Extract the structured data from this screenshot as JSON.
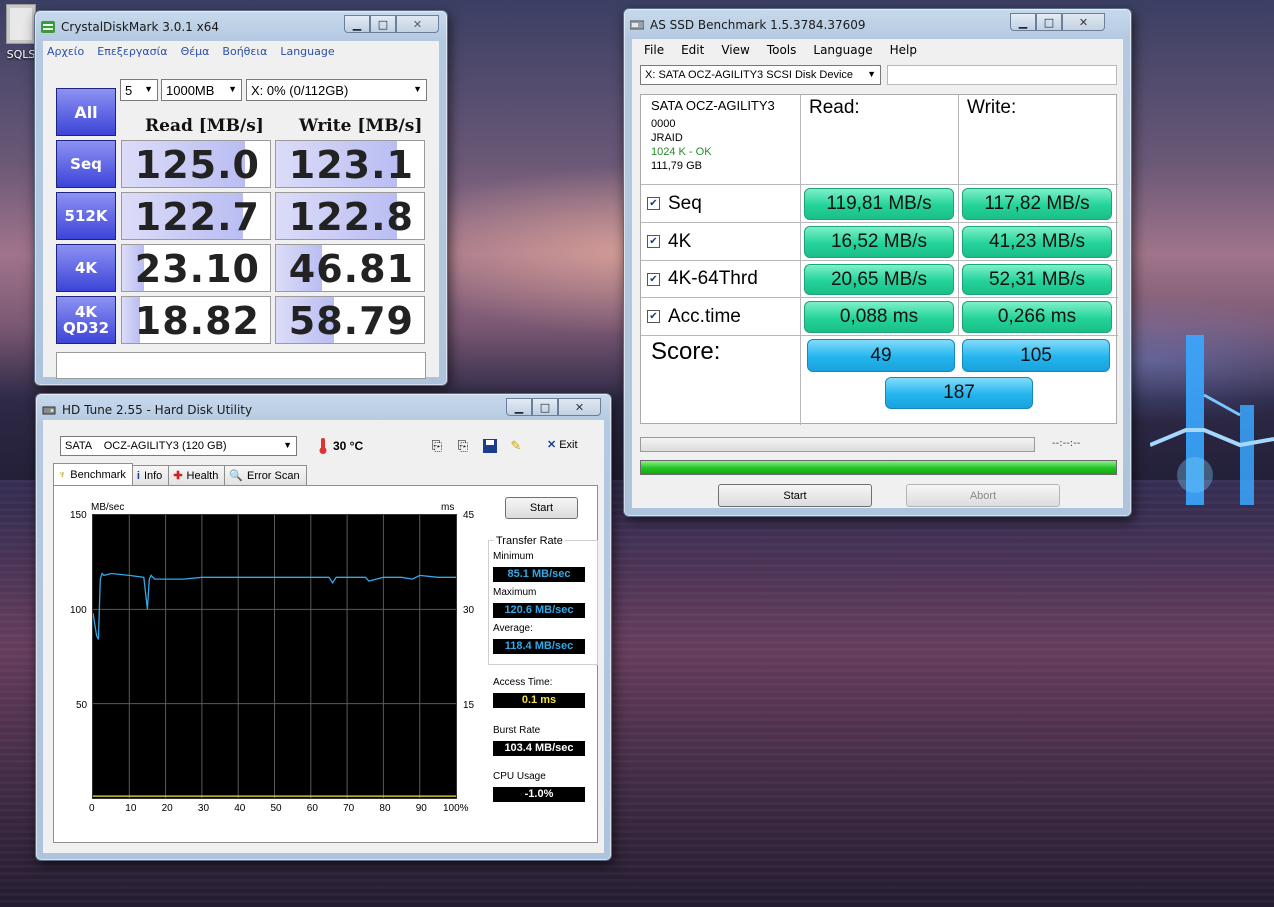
{
  "desktop": {
    "icon_label": "SQLS"
  },
  "cdm": {
    "title": "CrystalDiskMark 3.0.1 x64",
    "menu": [
      "Αρχείο",
      "Επεξεργασία",
      "Θέμα",
      "Βοήθεια",
      "Language"
    ],
    "all_label": "All",
    "runs": "5",
    "size": "1000MB",
    "drive": "X: 0% (0/112GB)",
    "read_header": "Read [MB/s]",
    "write_header": "Write [MB/s]",
    "rows": [
      {
        "label": "Seq",
        "read": "125.0",
        "write": "123.1",
        "read_fill": 0.83,
        "write_fill": 0.82
      },
      {
        "label": "512K",
        "read": "122.7",
        "write": "122.8",
        "read_fill": 0.82,
        "write_fill": 0.82
      },
      {
        "label": "4K",
        "read": "23.10",
        "write": "46.81",
        "read_fill": 0.15,
        "write_fill": 0.31
      },
      {
        "label": "4K\nQD32",
        "read": "18.82",
        "write": "58.79",
        "read_fill": 0.12,
        "write_fill": 0.39
      }
    ],
    "comment": ""
  },
  "asssd": {
    "title": "AS SSD Benchmark 1.5.3784.37609",
    "menu": [
      "File",
      "Edit",
      "View",
      "Tools",
      "Language",
      "Help"
    ],
    "drive_select": "X: SATA OCZ-AGILITY3 SCSI Disk Device",
    "drive_info": {
      "name": "SATA OCZ-AGILITY3",
      "fw": "0000",
      "driver": "JRAID",
      "align": "1024 K - OK",
      "size": "111,79 GB"
    },
    "read_header": "Read:",
    "write_header": "Write:",
    "tests": [
      {
        "label": "Seq",
        "read": "119,81 MB/s",
        "write": "117,82 MB/s"
      },
      {
        "label": "4K",
        "read": "16,52 MB/s",
        "write": "41,23 MB/s"
      },
      {
        "label": "4K-64Thrd",
        "read": "20,65 MB/s",
        "write": "52,31 MB/s"
      },
      {
        "label": "Acc.time",
        "read": "0,088 ms",
        "write": "0,266 ms"
      }
    ],
    "score_label": "Score:",
    "score_read": "49",
    "score_write": "105",
    "score_total": "187",
    "timer": "--:--:--",
    "progress": 1.0,
    "start_label": "Start",
    "abort_label": "Abort",
    "colors": {
      "result": "#23d39a",
      "score": "#23b5ee",
      "align_ok": "#2a8a2a"
    }
  },
  "hdtune": {
    "title": "HD Tune 2.55 - Hard Disk Utility",
    "drive": "SATA    OCZ-AGILITY3 (120 GB)",
    "temperature": "30 °C",
    "exit_label": "Exit",
    "tabs": [
      "Benchmark",
      "Info",
      "Health",
      "Error Scan"
    ],
    "start_label": "Start",
    "transfer_rate_label": "Transfer Rate",
    "minimum_label": "Minimum",
    "minimum": "85.1 MB/sec",
    "maximum_label": "Maximum",
    "maximum": "120.6 MB/sec",
    "average_label": "Average:",
    "average": "118.4 MB/sec",
    "access_label": "Access Time:",
    "access": "0.1 ms",
    "burst_label": "Burst Rate",
    "burst": "103.4 MB/sec",
    "cpu_label": "CPU Usage",
    "cpu": "-1.0%",
    "colors": {
      "transfer": "#33a8e6",
      "access": "#f2e24a"
    }
  },
  "chart_data": {
    "type": "line",
    "ylabel": "MB/sec",
    "ylabel2": "ms",
    "ylim": [
      0,
      150
    ],
    "ylim2": [
      0,
      45
    ],
    "yticks": [
      "150",
      "100",
      "50"
    ],
    "yticks2": [
      "45",
      "30",
      "15"
    ],
    "xticks": [
      "0",
      "10",
      "20",
      "30",
      "40",
      "50",
      "60",
      "70",
      "80",
      "90",
      "100%"
    ],
    "series": [
      {
        "values_x": [
          0,
          0.5,
          1,
          1.5,
          2,
          2.5,
          3,
          5,
          10,
          14,
          15,
          15.5,
          16,
          17,
          20,
          25,
          30,
          35,
          40,
          45,
          50,
          55,
          60,
          65,
          66,
          67,
          70,
          75,
          76,
          80,
          85,
          88,
          90,
          95,
          100
        ],
        "values_y": [
          98,
          92,
          86,
          84,
          116,
          119,
          118,
          119,
          118,
          117,
          100,
          116,
          118,
          116,
          116,
          116,
          117,
          117,
          117,
          117,
          117,
          117,
          117,
          117,
          114,
          117,
          117,
          117,
          115,
          117,
          117,
          116,
          118,
          117,
          117
        ]
      },
      {
        "values_x": [
          0,
          100
        ],
        "values_y": [
          0.3,
          0.3
        ]
      }
    ]
  }
}
